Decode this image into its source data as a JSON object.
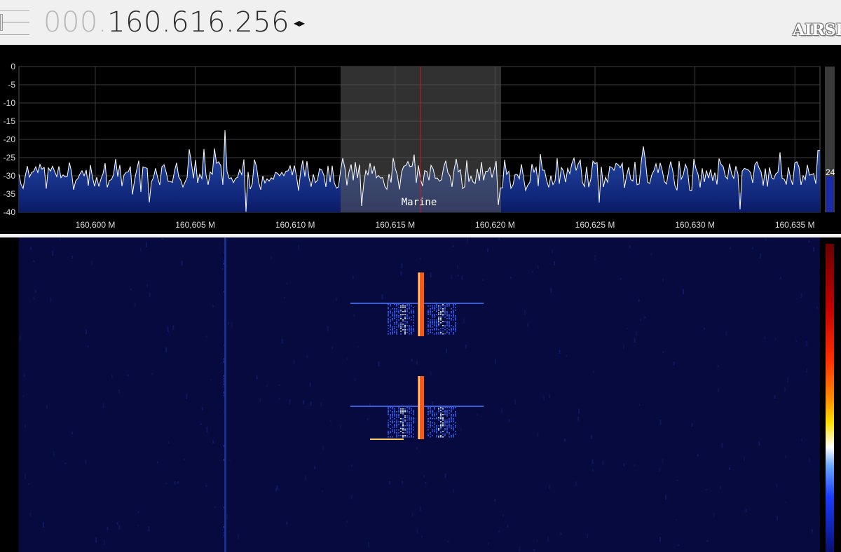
{
  "header": {
    "frequency_dim": "000.",
    "frequency_lit": "160.616.256",
    "step_arrows": "◂▸",
    "logo_text": "AIRSPY"
  },
  "spectrum": {
    "y_axis_labels": [
      "0",
      "-5",
      "-10",
      "-15",
      "-20",
      "-25",
      "-30",
      "-35",
      "-40"
    ],
    "x_axis_labels": [
      "160,600 M",
      "160,605 M",
      "160,610 M",
      "160,615 M",
      "160,620 M",
      "160,625 M",
      "160,630 M",
      "160,635 M"
    ],
    "band_label": "Marine",
    "gain_value": "24",
    "colors": {
      "trace": "#ffffff",
      "fill_top": "#3b67b8",
      "fill_bottom": "#0a1a66",
      "band_fill": "#0b1a6e",
      "filter_passband": "#3a3a3a",
      "center_line": "#e01010",
      "grid": "#444444"
    }
  },
  "waterfall": {
    "colors": {
      "background": "#060a3e",
      "carrier": "#ff5a10",
      "signal": "#4a8cff"
    }
  }
}
